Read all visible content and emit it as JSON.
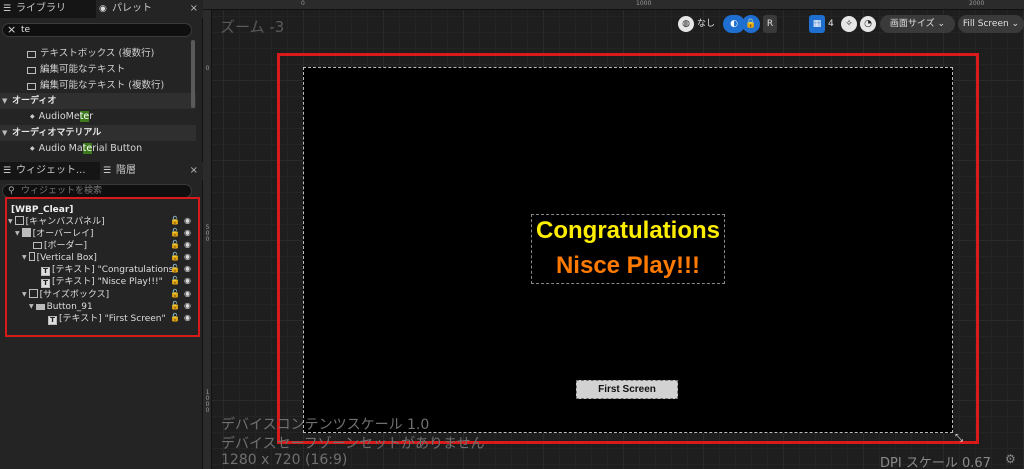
{
  "left_panel": {
    "tabs_top": [
      {
        "label": "ライブラリ",
        "icon": "library-icon"
      },
      {
        "label": "パレット",
        "icon": "palette-icon"
      }
    ],
    "close_glyph": "×",
    "search": {
      "value": "te"
    },
    "palette_rows": [
      {
        "label": "テキストボックス (複数行)"
      },
      {
        "label": "編集可能なテキスト"
      },
      {
        "label": "編集可能なテキスト (複数行)"
      }
    ],
    "categories": [
      {
        "label": "オーディオ",
        "item_pre": "AudioMe",
        "item_hl": "te",
        "item_post": "r"
      },
      {
        "label": "オーディオマテリアル",
        "item_pre": "Audio Ma",
        "item_hl": "te",
        "item_post": "rial Button"
      }
    ],
    "tabs_bottom": [
      {
        "label": "ウィジェット...",
        "icon": "widget-icon"
      },
      {
        "label": "階層",
        "icon": "hierarchy-icon"
      }
    ],
    "hierarchy_search_placeholder": "ウィジェットを検索",
    "hierarchy": {
      "root": "[WBP_Clear]",
      "items": [
        {
          "label": "[キャンバスパネル]"
        },
        {
          "label": "[オーバーレイ]"
        },
        {
          "label": "[ボーダー]"
        },
        {
          "label": "[Vertical Box]"
        },
        {
          "label": "[テキスト] \"Congratulations"
        },
        {
          "label": "[テキスト] \"Nisce Play!!!\""
        },
        {
          "label": "[サイズボックス]"
        },
        {
          "label": "Button_91"
        },
        {
          "label": "[テキスト] \"First Screen\""
        }
      ]
    }
  },
  "viewport": {
    "zoom_label": "ズーム -3",
    "ruler_top": [
      "0",
      "1000",
      "2000"
    ],
    "ruler_left": [
      "0",
      "5 0 0",
      "1 0 0 0"
    ],
    "toolbar": {
      "none_label": "なし",
      "r_label": "R",
      "grid_count": "4",
      "screen_size_label": "画面サイズ ⌄",
      "fill_screen_label": "Fill Screen ⌄"
    },
    "canvas": {
      "congrats_text": "Congratulations",
      "nisce_text": "Nisce Play!!!",
      "button_text": "First Screen"
    },
    "info": {
      "content_scale": "デバイスコンテンツスケール 1.0",
      "safe_zone": "デバイスセーフゾーンセットがありません",
      "resolution": "1280 x 720 (16:9)",
      "dpi": "DPI スケール 0.67"
    }
  },
  "colors": {
    "accent_blue": "#1f6fd1",
    "highlight_red": "#d91a1a",
    "congrats_yellow": "#ffee00",
    "nisce_orange": "#ff7a00",
    "search_highlight_green": "#3d7a1e"
  }
}
